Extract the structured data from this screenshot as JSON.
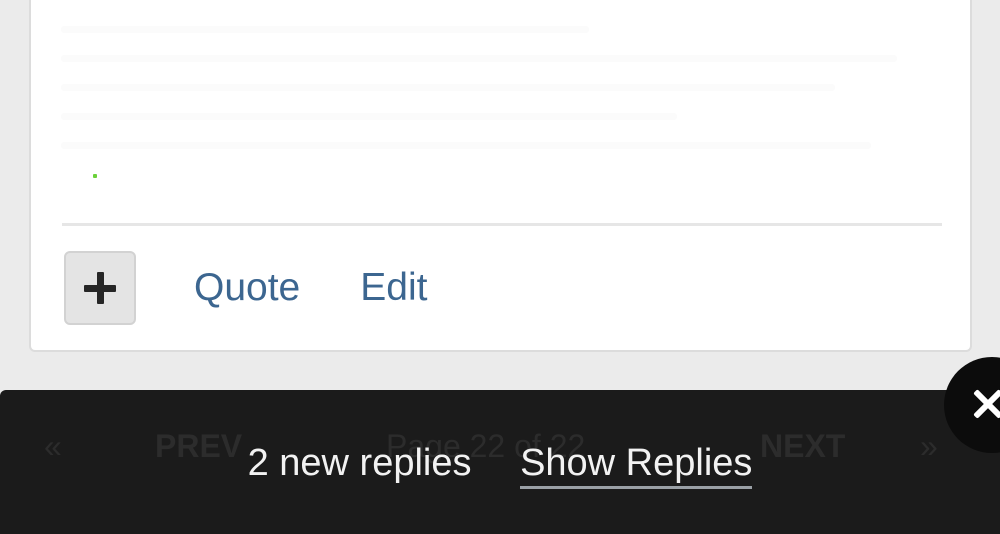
{
  "post": {
    "actions": {
      "plus_icon": "plus-icon",
      "quote_label": "Quote",
      "edit_label": "Edit"
    }
  },
  "pager": {
    "first_icon": "«",
    "prev_label": "PREV",
    "page_info": "Page 22 of 22",
    "next_label": "NEXT",
    "last_icon": "»"
  },
  "toast": {
    "count_text": "2 new replies",
    "show_label": "Show Replies"
  },
  "close_button": {
    "icon": "close-icon"
  },
  "colors": {
    "link": "#3c6690",
    "toast_bg": "#1b1b1b",
    "toast_text": "#f2f2f2"
  }
}
